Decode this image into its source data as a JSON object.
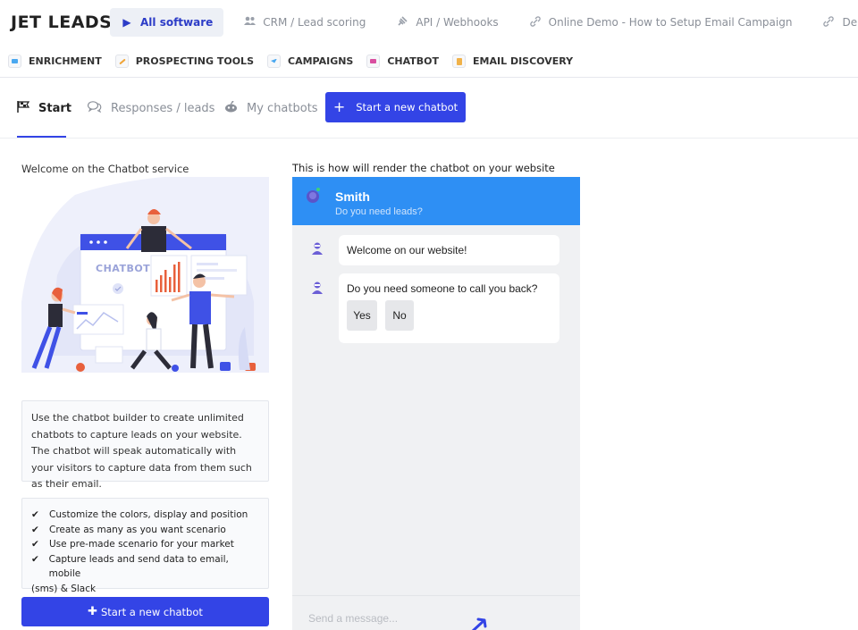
{
  "app": {
    "logo": "JET LEADS"
  },
  "topnav": {
    "items": [
      {
        "label": "All software",
        "icon": "play-icon",
        "active": true
      },
      {
        "label": "CRM / Lead scoring",
        "icon": "users-icon",
        "active": false
      },
      {
        "label": "API / Webhooks",
        "icon": "plug-icon",
        "active": false
      },
      {
        "label": "Online Demo - How to Setup Email Campaign",
        "icon": "link-icon",
        "active": false
      },
      {
        "label": "Demo - How to Create",
        "icon": "link-icon",
        "active": false
      }
    ]
  },
  "subnav": {
    "items": [
      {
        "label": "ENRICHMENT",
        "icon": "enrichment-icon",
        "color": "#4aa8f0"
      },
      {
        "label": "PROSPECTING TOOLS",
        "icon": "wand-icon",
        "color": "#f0a63a"
      },
      {
        "label": "CAMPAIGNS",
        "icon": "paper-plane-icon",
        "color": "#4aa8f0"
      },
      {
        "label": "CHATBOT",
        "icon": "chat-icon",
        "color": "#d94fa0"
      },
      {
        "label": "EMAIL DISCOVERY",
        "icon": "document-icon",
        "color": "#f0b24a"
      }
    ]
  },
  "tabs": {
    "start": "Start",
    "responses": "Responses / leads",
    "my_chatbots": "My chatbots",
    "new_chatbot": "Start a new chatbot"
  },
  "left": {
    "welcome": "Welcome on the Chatbot service",
    "illustration_text": "CHATBOT",
    "info": "Use the chatbot builder to create unlimited chatbots to capture leads on your website. The chatbot will speak automatically with your visitors to capture data from them such as their email.",
    "features": [
      "Customize the colors, display and position",
      "Create as many as you want scenario",
      "Use pre-made scenario for your market",
      "Capture leads and send data to email, mobile"
    ],
    "features_tail": "(sms) & Slack",
    "button": "Start a new chatbot"
  },
  "preview": {
    "label": "This is how will render the chatbot on your website",
    "bot_name": "Smith",
    "bot_subtitle": "Do you need leads?",
    "messages": [
      "Welcome on our website!",
      "Do you need someone to call you back?"
    ],
    "options": {
      "yes": "Yes",
      "no": "No"
    },
    "input_placeholder": "Send a message...",
    "header_color": "#2e8ff4"
  },
  "colors": {
    "accent": "#3344e6"
  }
}
